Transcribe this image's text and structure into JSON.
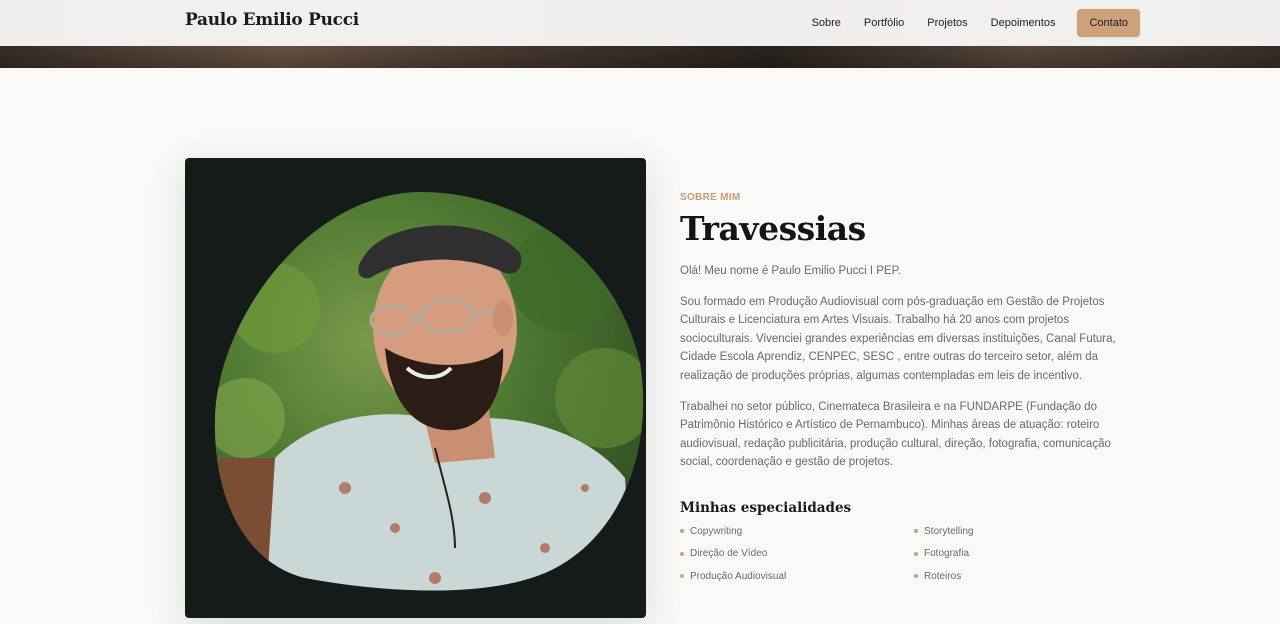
{
  "brand": "Paulo Emilio Pucci",
  "nav": {
    "links": [
      "Sobre",
      "Portfólio",
      "Projetos",
      "Depoimentos"
    ],
    "cta": "Contato"
  },
  "about": {
    "eyebrow": "SOBRE MIM",
    "title": "Travessias",
    "paragraphs": [
      "Olá! Meu nome é Paulo Emilio Pucci I PEP.",
      "Sou formado em Produção Audiovisual com pós-graduação em Gestão de Projetos Culturais e Licenciatura em Artes Visuais. Trabalho há 20 anos com projetos socioculturais. Vivenciei grandes experiências em diversas instituições, Canal Futura, Cidade Escola Aprendiz, CENPEC, SESC , entre outras do terceiro setor, além da realização de produções próprias, algumas contempladas em leis de incentivo.",
      "Trabalhei no setor público, Cinemateca Brasileira e na FUNDARPE (Fundação do Patrimônio Histórico e Artístico de Pernambuco). Minhas áreas de atuação: roteiro audiovisual, redação publicitária, produção cultural, direção, fotografia, comunicação social, coordenação e gestão de projetos."
    ],
    "specialties_title": "Minhas especialidades",
    "specialties": [
      "Copywriting",
      "Storytelling",
      "Direção de Vídeo",
      "Fotografia",
      "Produção Audiovisual",
      "Roteiros"
    ]
  },
  "colors": {
    "accent": "#cda27a",
    "photo_card_bg": "#151b18"
  }
}
